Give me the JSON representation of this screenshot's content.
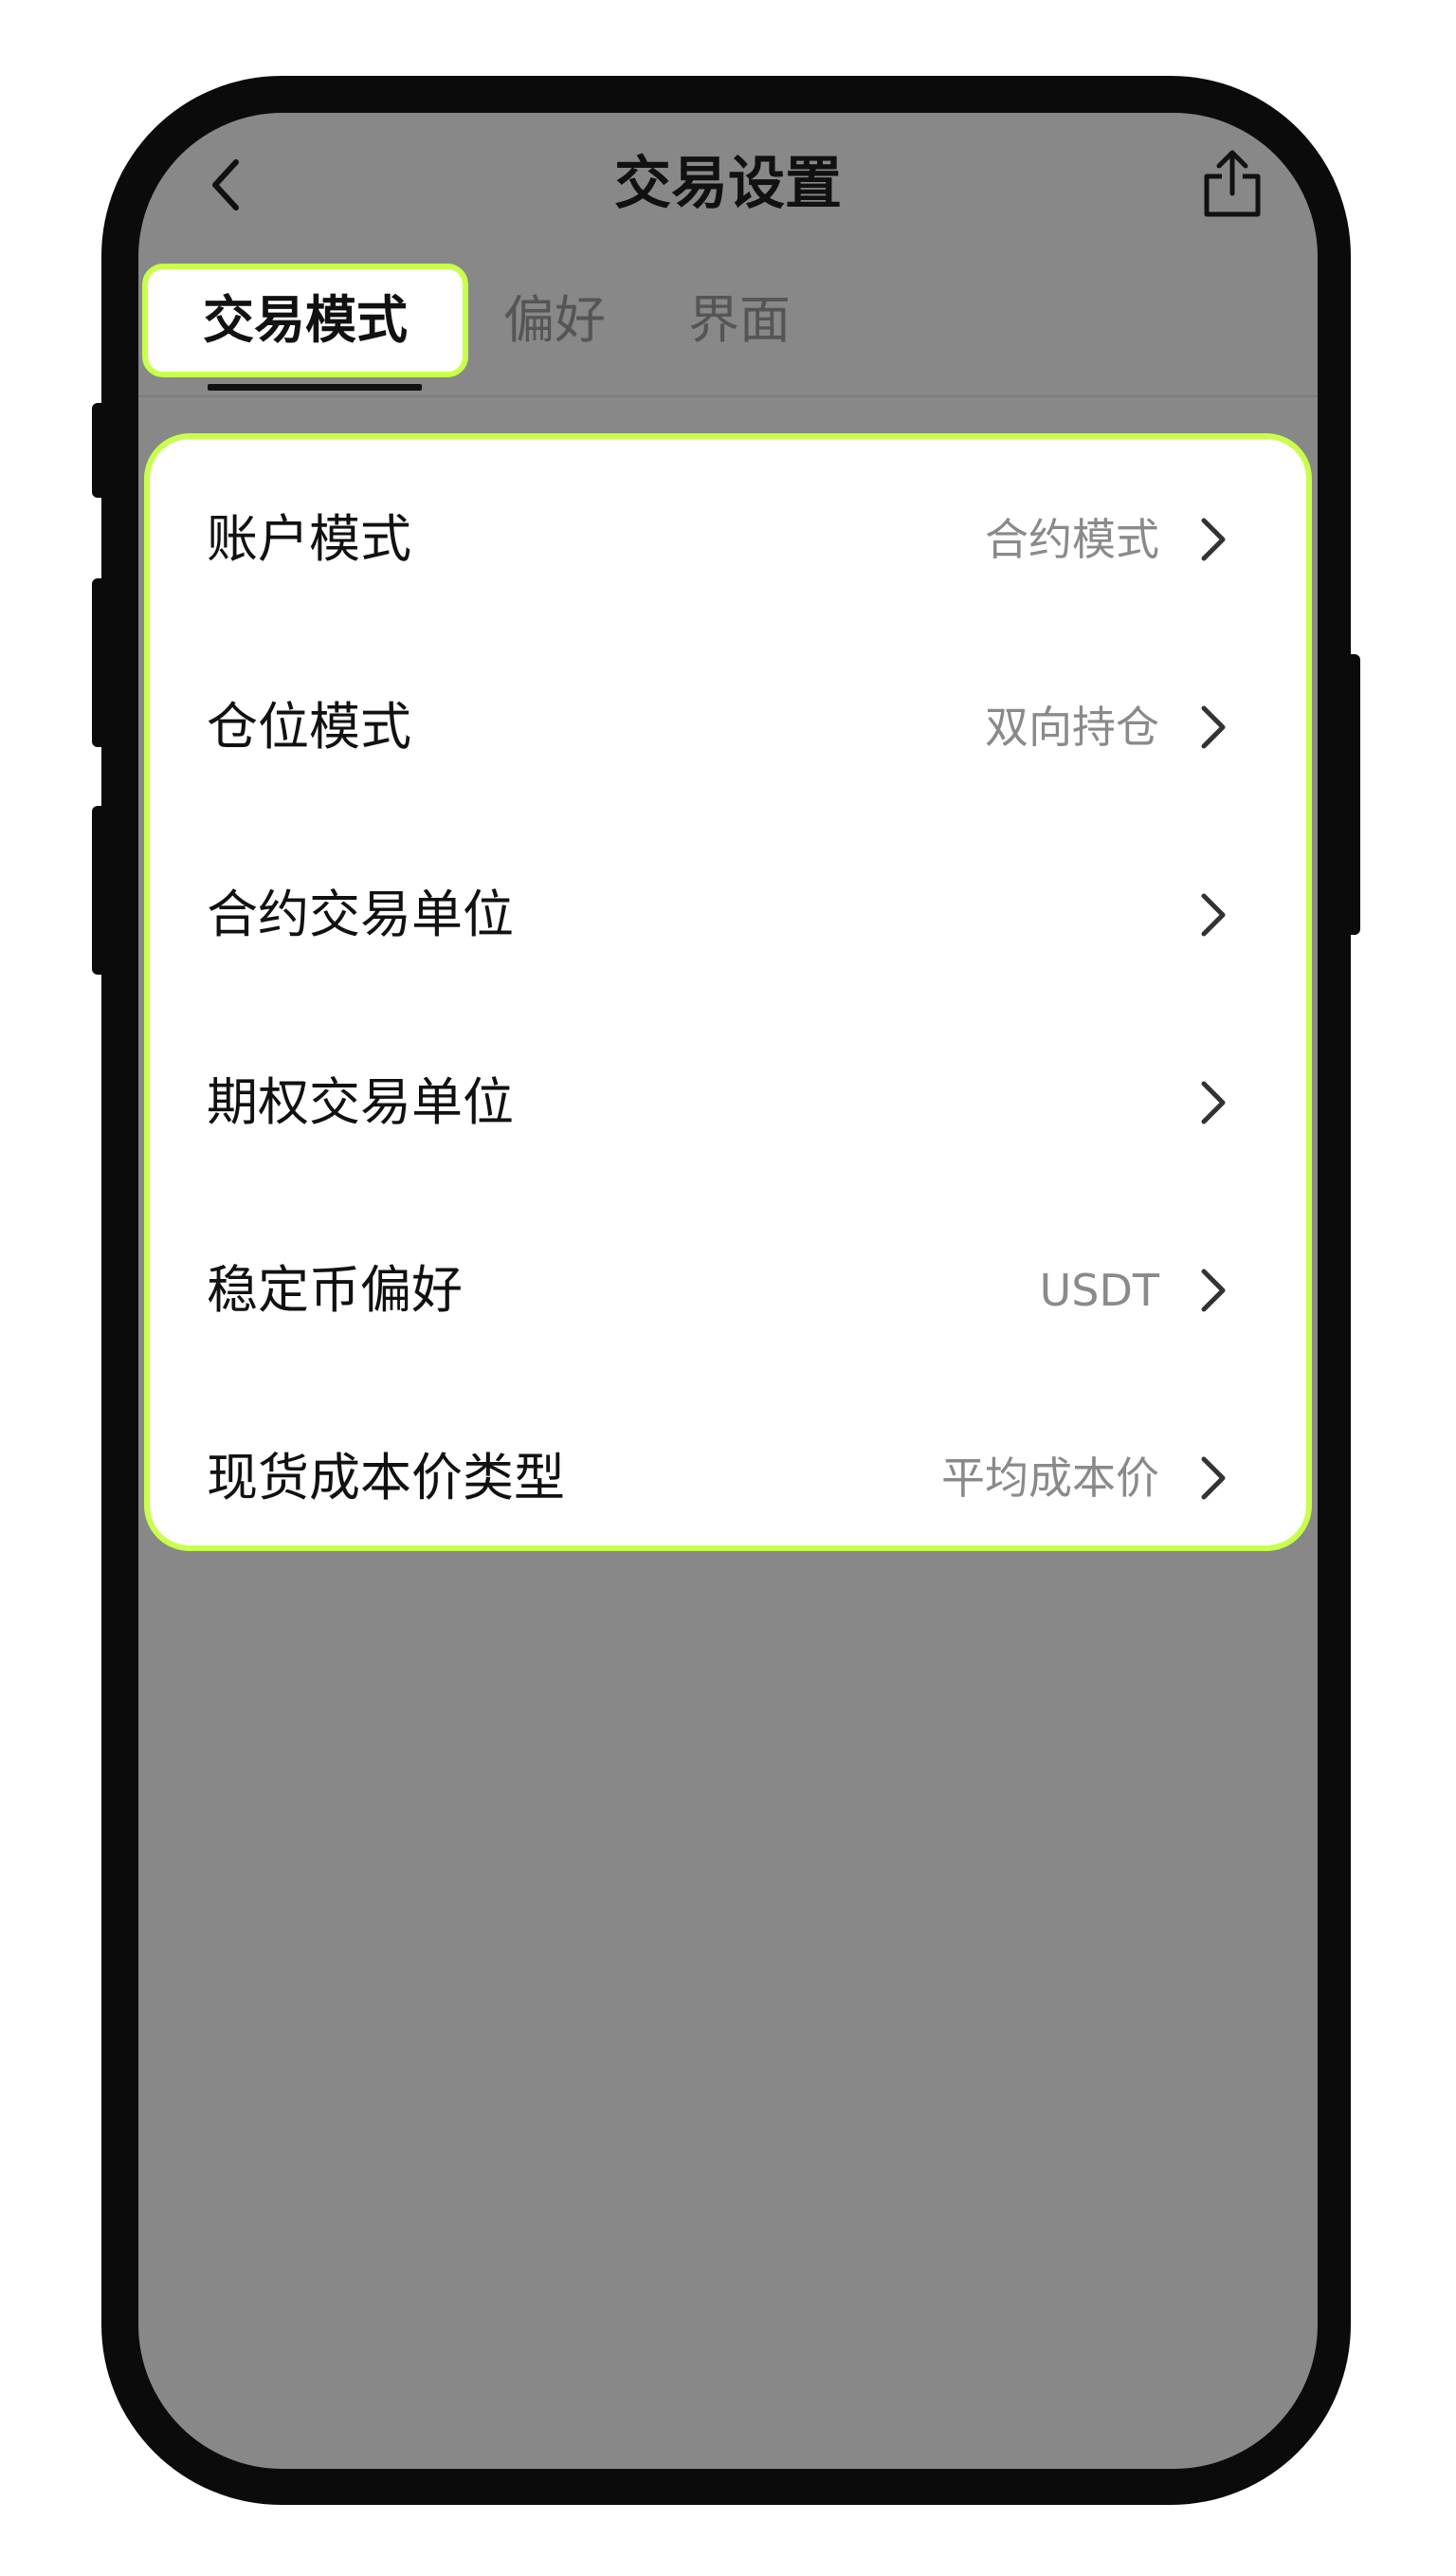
{
  "header": {
    "title": "交易设置"
  },
  "tabs": [
    {
      "label": "交易模式",
      "active": true
    },
    {
      "label": "偏好",
      "active": false
    },
    {
      "label": "界面",
      "active": false
    }
  ],
  "settings": [
    {
      "label": "账户模式",
      "value": "合约模式"
    },
    {
      "label": "仓位模式",
      "value": "双向持仓"
    },
    {
      "label": "合约交易单位",
      "value": ""
    },
    {
      "label": "期权交易单位",
      "value": ""
    },
    {
      "label": "稳定币偏好",
      "value": "USDT"
    },
    {
      "label": "现货成本价类型",
      "value": "平均成本价"
    }
  ],
  "colors": {
    "highlight": "#c8ff4a",
    "screen_bg": "#888888",
    "card_bg": "#ffffff"
  },
  "icons": {
    "back": "chevron-left-icon",
    "share": "share-icon",
    "row": "chevron-right-icon"
  }
}
